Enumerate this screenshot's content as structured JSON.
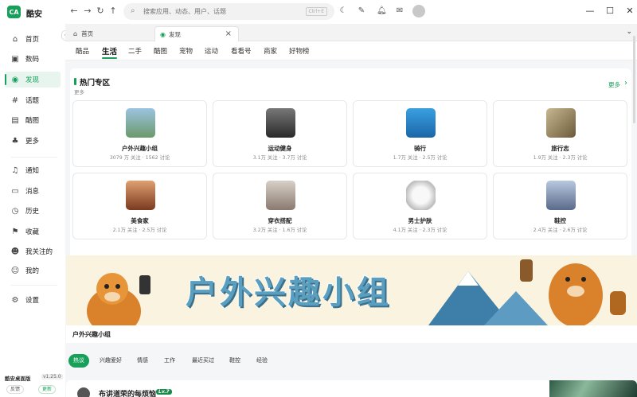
{
  "app": {
    "name": "酷安",
    "logo_text": "CA"
  },
  "search": {
    "placeholder": "搜索应用、动态、用户、话题",
    "shortcut": "Ctrl+E"
  },
  "tabs": [
    {
      "label": "首页"
    },
    {
      "label": "发现"
    }
  ],
  "sidebar": {
    "items": [
      {
        "label": "首页",
        "icon": "home-icon"
      },
      {
        "label": "数码",
        "icon": "chip-icon"
      },
      {
        "label": "发现",
        "icon": "compass-icon"
      },
      {
        "label": "话题",
        "icon": "hashtag-icon"
      },
      {
        "label": "酷图",
        "icon": "image-icon"
      },
      {
        "label": "更多",
        "icon": "more-shapes-icon"
      },
      {
        "label": "通知",
        "icon": "bell-icon"
      },
      {
        "label": "消息",
        "icon": "message-icon"
      },
      {
        "label": "历史",
        "icon": "clock-icon"
      },
      {
        "label": "收藏",
        "icon": "bookmark-icon"
      },
      {
        "label": "我关注的",
        "icon": "users-icon"
      },
      {
        "label": "我的",
        "icon": "user-icon"
      },
      {
        "label": "设置",
        "icon": "gear-icon"
      }
    ],
    "footer": {
      "title": "酷安桌面版",
      "version": "v1.25.0",
      "feedback": "反馈",
      "update": "更新"
    }
  },
  "categories": [
    "酷品",
    "生活",
    "二手",
    "酷图",
    "宠物",
    "运动",
    "看看号",
    "商家",
    "好物榜"
  ],
  "hot": {
    "title": "热门专区",
    "subtitle": "更多",
    "more": "更多",
    "cards": [
      {
        "name": "户外兴趣小组",
        "stats": "3079 万 关注 · 1562 讨论",
        "color": "#6a9a6a"
      },
      {
        "name": "运动健身",
        "stats": "3.1万 关注 · 3.7万 讨论",
        "color": "#4a4a4a"
      },
      {
        "name": "骑行",
        "stats": "1.7万 关注 · 2.5万 讨论",
        "color": "#2a86c8"
      },
      {
        "name": "旅行志",
        "stats": "1.9万 关注 · 2.3万 讨论",
        "color": "#8a7a5a"
      },
      {
        "name": "美食家",
        "stats": "2.1万 关注 · 2.5万 讨论",
        "color": "#b06a40"
      },
      {
        "name": "穿衣搭配",
        "stats": "3.2万 关注 · 1.6万 讨论",
        "color": "#b8a8a0"
      },
      {
        "name": "男士护肤",
        "stats": "4.1万 关注 · 2.3万 讨论",
        "color": "#e8e8e8"
      },
      {
        "name": "鞋控",
        "stats": "2.4万 关注 · 2.6万 讨论",
        "color": "#8a9ab8"
      }
    ]
  },
  "banner": {
    "text": "户外兴趣小组",
    "caption": "户外兴趣小组"
  },
  "pills": [
    "热议",
    "兴趣爱好",
    "情感",
    "工作",
    "最近买过",
    "鞋控",
    "经验"
  ],
  "post": {
    "author": "布讲道荣的每烦恼",
    "badge": "Lv.7"
  },
  "colors": {
    "accent": "#16a05a"
  }
}
